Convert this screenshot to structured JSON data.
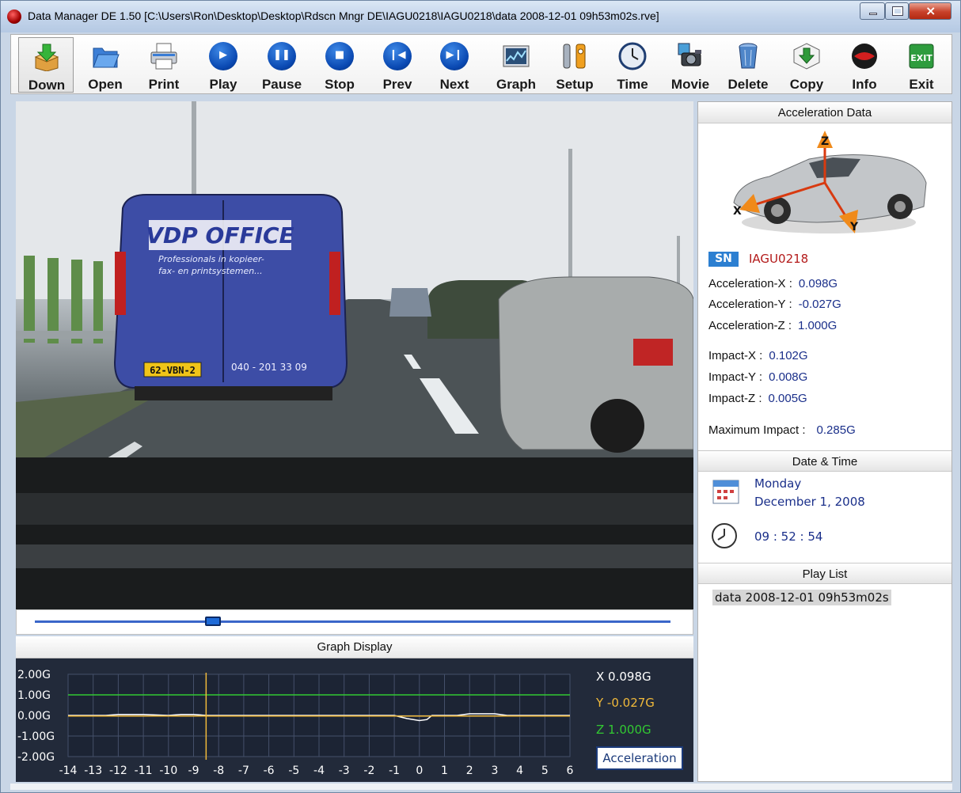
{
  "window": {
    "title": "Data Manager DE 1.50  [C:\\Users\\Ron\\Desktop\\Desktop\\Rdscn Mngr DE\\IAGU0218\\IAGU0218\\data 2008-12-01 09h53m02s.rve]"
  },
  "toolbar": {
    "down": "Down",
    "open": "Open",
    "print": "Print",
    "play": "Play",
    "pause": "Pause",
    "stop": "Stop",
    "prev": "Prev",
    "next": "Next",
    "graph": "Graph",
    "setup": "Setup",
    "time": "Time",
    "movie": "Movie",
    "delete": "Delete",
    "copy": "Copy",
    "info": "Info",
    "exit": "Exit",
    "exit_icon_text": "EXIT"
  },
  "video": {
    "van_brand": "VDP OFFICE",
    "van_line1": "Professionals in kopieer-",
    "van_line2": "fax- en printsystemen...",
    "plate": "62-VBN-2",
    "phone": "040 - 201 33 09"
  },
  "playback": {
    "position_fraction": 0.28
  },
  "graph": {
    "title": "Graph Display",
    "y_labels": [
      "2.00G",
      "1.00G",
      "0.00G",
      "-1.00G",
      "-2.00G"
    ],
    "x_labels": [
      "-14",
      "-13",
      "-12",
      "-11",
      "-10",
      "-9",
      "-8",
      "-7",
      "-6",
      "-5",
      "-4",
      "-3",
      "-2",
      "-1",
      "0",
      "1",
      "2",
      "3",
      "4",
      "5",
      "6"
    ],
    "legend_x": "X  0.098G",
    "legend_y": "Y  -0.027G",
    "legend_z": "Z  1.000G",
    "acceleration_button": "Acceleration",
    "cursor_x": -8.5,
    "colors": {
      "x": "#ffffff",
      "y": "#f0b93a",
      "z": "#32c832",
      "grid": "#44506a",
      "cursor": "#f0b93a"
    }
  },
  "acceleration": {
    "header": "Acceleration Data",
    "axis_x": "X",
    "axis_y": "Y",
    "axis_z": "Z",
    "sn_badge": "SN",
    "serial": "IAGU0218",
    "acc_x_label": "Acceleration-X :",
    "acc_x": "0.098G",
    "acc_y_label": "Acceleration-Y :",
    "acc_y": "-0.027G",
    "acc_z_label": "Acceleration-Z :",
    "acc_z": "1.000G",
    "imp_x_label": "Impact-X :",
    "imp_x": "0.102G",
    "imp_y_label": "Impact-Y :",
    "imp_y": "0.008G",
    "imp_z_label": "Impact-Z :",
    "imp_z": "0.005G",
    "max_label": "Maximum Impact :",
    "max": "0.285G"
  },
  "datetime": {
    "header": "Date & Time",
    "weekday": "Monday",
    "date": "December  1,  2008",
    "time": "09 : 52 : 54"
  },
  "playlist": {
    "header": "Play List",
    "items": [
      "data 2008-12-01 09h53m02s"
    ]
  }
}
